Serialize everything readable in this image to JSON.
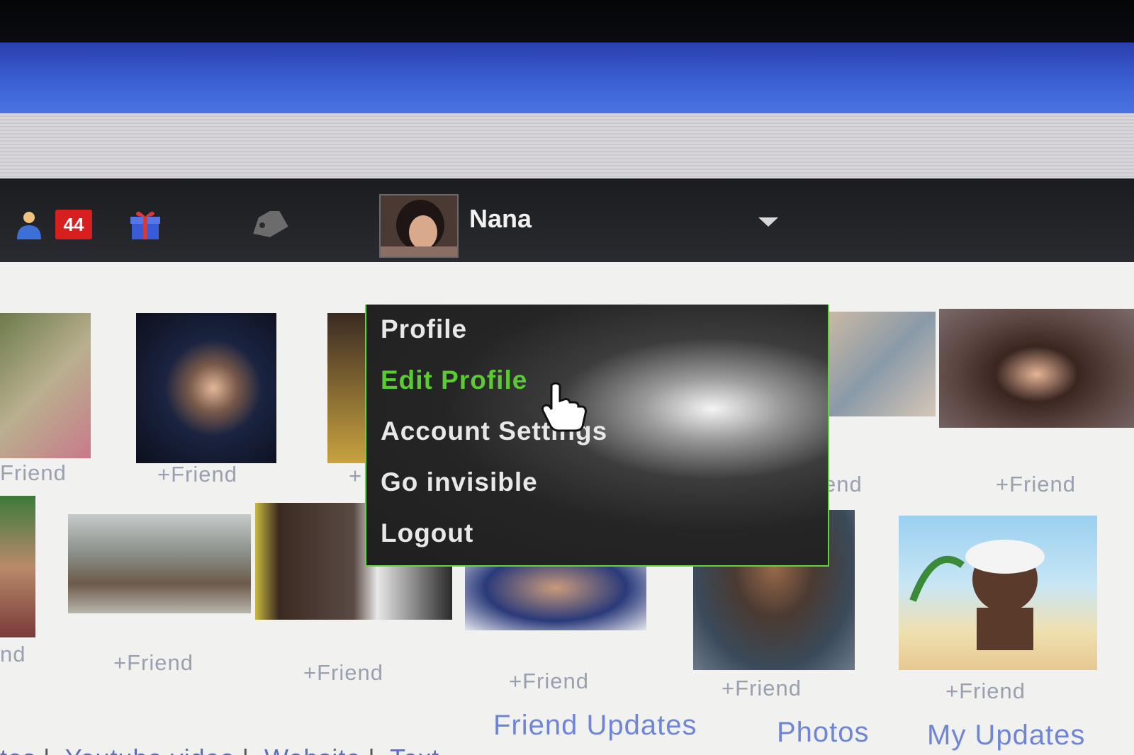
{
  "header": {
    "notification_count": "44",
    "user_name": "Nana"
  },
  "menu": {
    "items": [
      {
        "label": "Profile"
      },
      {
        "label": "Edit Profile"
      },
      {
        "label": "Account Settings"
      },
      {
        "label": "Go invisible"
      },
      {
        "label": "Logout"
      }
    ]
  },
  "friends": {
    "add_label": "+Friend",
    "partial_label_1": "Friend",
    "partial_label_2": "nd",
    "partial_label_3": "+",
    "partial_label_4": "end"
  },
  "tabs": {
    "friend_updates": "Friend Updates",
    "photos": "Photos",
    "my_updates": "My Updates"
  },
  "links": {
    "photos_partial": "tos",
    "youtube": "Youtube video",
    "website": "Website",
    "text": "Text"
  },
  "icons": {
    "friend": "friend-requests-icon",
    "gift": "gift-icon",
    "tag": "tag-icon",
    "dropdown": "chevron-down-icon",
    "cursor": "hand-cursor-icon"
  },
  "colors": {
    "accent_green": "#5bcb33",
    "badge_red": "#d71f1f",
    "link_blue": "#6f86d6"
  }
}
